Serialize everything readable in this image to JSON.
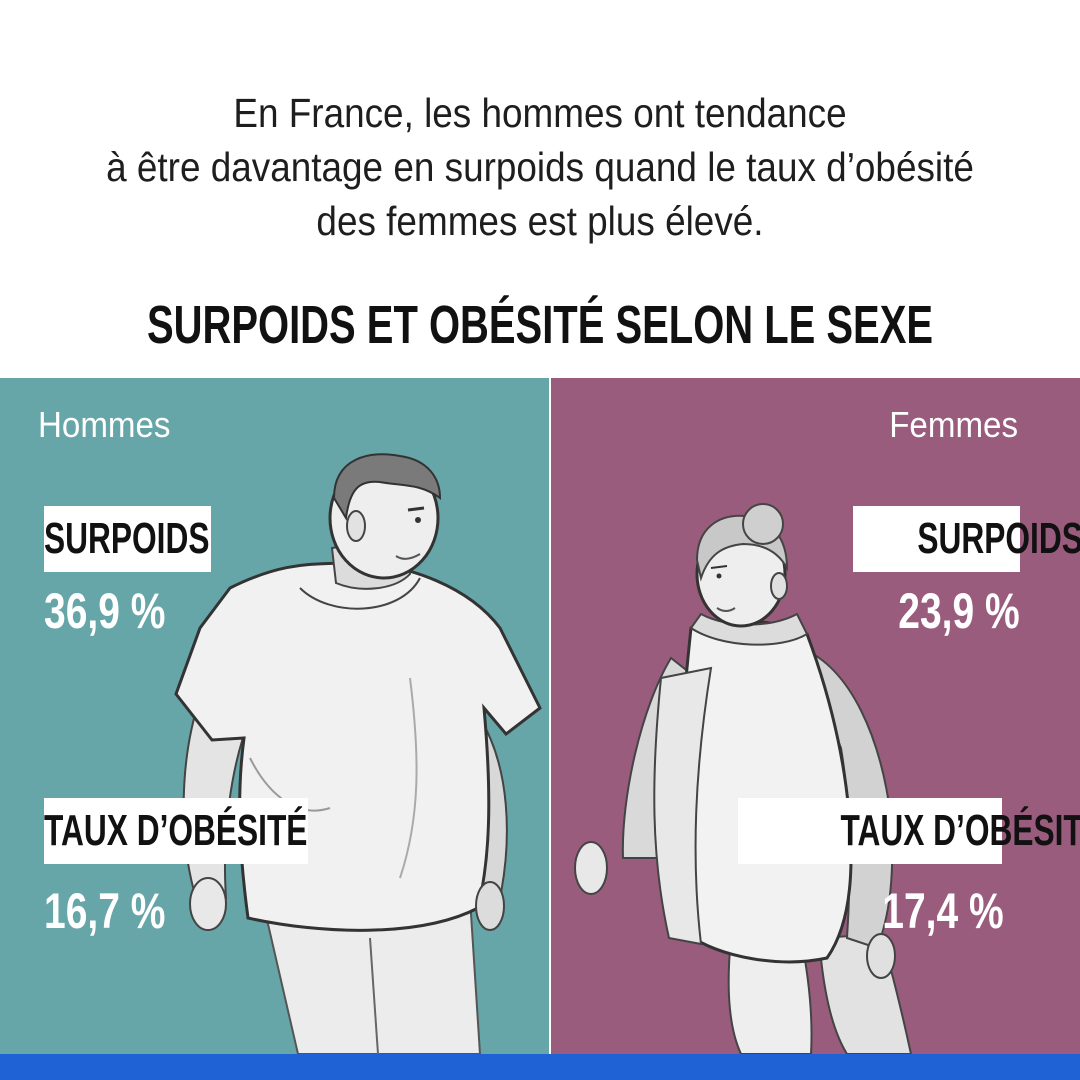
{
  "intro": {
    "line1": "En France, les hommes ont tendance",
    "line2": "à être davantage en surpoids quand le taux d’obésité",
    "line3": "des femmes est plus élevé."
  },
  "headline": "SURPOIDS ET OBÉSITÉ SELON LE SEXE",
  "men": {
    "label": "Hommes",
    "overweight_label": "SURPOIDS",
    "overweight_value": "36,9 %",
    "obesity_label": "TAUX D’OBÉSITÉ",
    "obesity_value": "16,7 %"
  },
  "women": {
    "label": "Femmes",
    "overweight_label": "SURPOIDS",
    "overweight_value": "23,9 %",
    "obesity_label": "TAUX D’OBÉSITÉ",
    "obesity_value": "17,4 %"
  },
  "colors": {
    "men_panel": "#66a5a8",
    "women_panel": "#9a5c7d",
    "bottom_bar": "#1f62d6"
  },
  "icons": [
    "man-illustration",
    "woman-illustration"
  ]
}
